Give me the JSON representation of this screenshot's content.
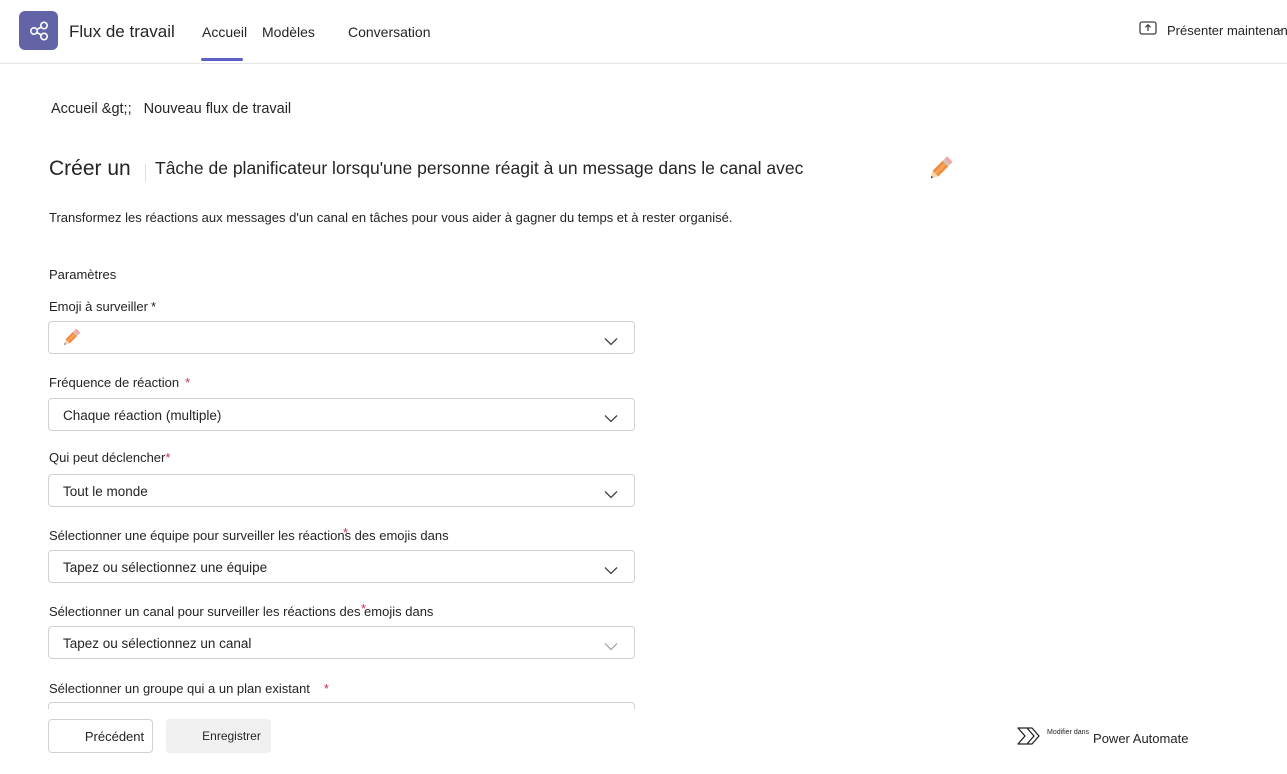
{
  "header": {
    "app_title": "Flux de travail",
    "tabs": [
      {
        "label": "Accueil",
        "active": true
      },
      {
        "label": "Modèles",
        "active": false
      },
      {
        "label": "Conversation",
        "active": false
      }
    ],
    "present_label": "Présenter maintenant",
    "more_label": "...",
    "accent_color": "#5b5fc7",
    "app_icon": "share-nodes-icon"
  },
  "breadcrumb": {
    "home": "Accueil",
    "separator": "&gt;",
    "current": "Nouveau flux de travail"
  },
  "page": {
    "title_prefix": "Créer un",
    "title_text": "Tâche de planificateur lorsqu'une personne réagit à un message dans le canal avec",
    "title_icon": "pencil-icon",
    "description": "Transformez les réactions aux messages d'un canal en tâches pour vous aider à gagner du temps et à rester organisé.",
    "section_title": "Paramètres"
  },
  "fields": [
    {
      "label": "Emoji à surveiller",
      "required_mark": "*",
      "value_icon": "pencil-emoji-icon",
      "value": ""
    },
    {
      "label": "Fréquence de réaction",
      "required_mark": "*",
      "value": "Chaque réaction (multiple)"
    },
    {
      "label": "Qui peut déclencher",
      "required_mark": "*",
      "value": "Tout le monde"
    },
    {
      "label": "Sélectionner une équipe pour surveiller les réactions des emojis dans",
      "required_mark": "*",
      "value": "Tapez ou sélectionnez une équipe"
    },
    {
      "label": "Sélectionner un canal pour surveiller les réactions des emojis dans",
      "required_mark": "*",
      "value": "Tapez ou sélectionnez un canal"
    },
    {
      "label": "Sélectionner un groupe qui a un plan existant",
      "required_mark": "*",
      "value": ""
    }
  ],
  "footer": {
    "previous_label": "Précédent",
    "save_label": "Enregistrer",
    "edit_in_label": "Modifier dans",
    "power_automate_label": "Power Automate"
  }
}
